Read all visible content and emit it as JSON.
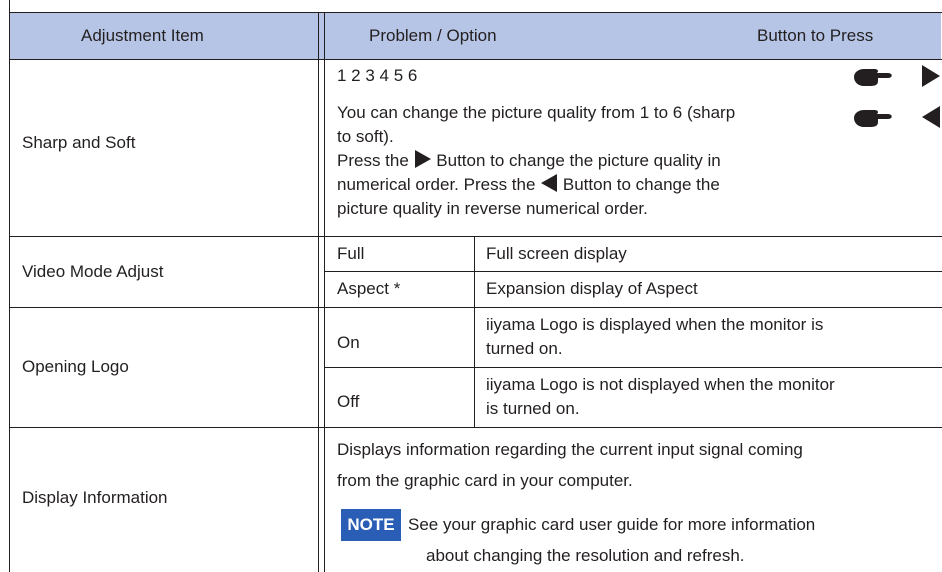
{
  "header": {
    "col1": "Adjustment Item",
    "col2": "Problem / Option",
    "col3": "Button to Press"
  },
  "rows": {
    "sharp": {
      "item": "Sharp and Soft",
      "levels": "1 2 3 4 5 6",
      "desc1a": "You can change the picture quality from 1 to 6 (sharp",
      "desc1b": "to soft).",
      "press1": "Press the",
      "press1_rest": "Button to change the picture quality in",
      "press2": "numerical order. Press the",
      "press2_rest": "Button to change the",
      "press3": "picture quality in reverse numerical order."
    },
    "video": {
      "item": "Video Mode Adjust",
      "opt1": "Full",
      "opt1_desc": "Full screen display",
      "opt2": "Aspect *",
      "opt2_desc": "Expansion display of Aspect"
    },
    "logo": {
      "item": "Opening Logo",
      "opt1": "On",
      "opt1_desc_a": "iiyama Logo is displayed when the monitor is",
      "opt1_desc_b": "turned on.",
      "opt2": "Off",
      "opt2_desc_a": "iiyama Logo is not displayed when the monitor",
      "opt2_desc_b": "is turned on."
    },
    "info": {
      "item": "Display Information",
      "desc_a": "Displays information regarding the current input signal coming",
      "desc_b": "from the graphic card in your computer.",
      "note_label": "NOTE",
      "note_a": "See your graphic card user guide for more information",
      "note_b": "about changing the resolution and refresh."
    }
  },
  "icons": {
    "hand": "pointing-hand-icon",
    "right": "right-triangle-icon",
    "left": "left-triangle-icon"
  },
  "colors": {
    "header_bg": "#b6c5e6",
    "note_bg": "#2a5db5",
    "text": "#231f20"
  }
}
